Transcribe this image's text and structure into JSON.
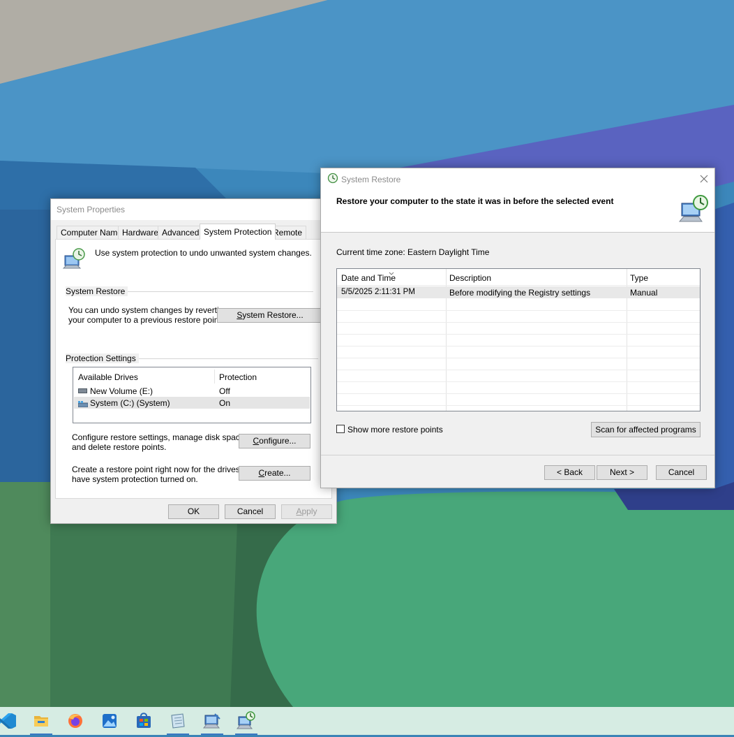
{
  "system_properties": {
    "title": "System Properties",
    "tabs": [
      {
        "label": "Computer Name"
      },
      {
        "label": "Hardware"
      },
      {
        "label": "Advanced"
      },
      {
        "label": "System Protection",
        "active": true
      },
      {
        "label": "Remote"
      }
    ],
    "intro_text": "Use system protection to undo unwanted system changes.",
    "system_restore_group": {
      "title": "System Restore",
      "desc_line1": "You can undo system changes by reverting",
      "desc_line2": "your computer to a previous restore point.",
      "button": "System Restore..."
    },
    "protection_group": {
      "title": "Protection Settings",
      "columns": [
        "Available Drives",
        "Protection"
      ],
      "drives": [
        {
          "name": "New Volume (E:)",
          "protection": "Off"
        },
        {
          "name": "System (C:) (System)",
          "protection": "On",
          "selected": true
        }
      ],
      "configure_line1": "Configure restore settings, manage disk space,",
      "configure_line2": "and delete restore points.",
      "configure_button": "Configure...",
      "create_line1": "Create a restore point right now for the drives that",
      "create_line2": "have system protection turned on.",
      "create_button": "Create..."
    },
    "buttons": {
      "ok": "OK",
      "cancel": "Cancel",
      "apply": "Apply"
    }
  },
  "system_restore": {
    "title": "System Restore",
    "heading": "Restore your computer to the state it was in before the selected event",
    "timezone": "Current time zone: Eastern Daylight Time",
    "columns": [
      "Date and Time",
      "Description",
      "Type"
    ],
    "rows": [
      {
        "date": "5/5/2025 2:11:31 PM",
        "description": "Before modifying the Registry settings",
        "type": "Manual"
      }
    ],
    "show_more_label": "Show more restore points",
    "show_more_checked": false,
    "scan_button": "Scan for affected programs",
    "back_button": "< Back",
    "next_button": "Next >",
    "cancel_button": "Cancel"
  },
  "taskbar": {
    "icons": [
      {
        "name": "vscode-icon",
        "active": false
      },
      {
        "name": "file-explorer-icon",
        "active": true
      },
      {
        "name": "firefox-icon",
        "active": false
      },
      {
        "name": "photos-icon",
        "active": false
      },
      {
        "name": "store-icon",
        "active": false
      },
      {
        "name": "notepad-icon",
        "active": true
      },
      {
        "name": "system-properties-icon",
        "active": true
      },
      {
        "name": "system-restore-icon",
        "active": true
      }
    ]
  },
  "colors": {
    "taskbar": "#d6ece3",
    "accent": "#3a78c2",
    "window_bg": "#f0f0f0"
  }
}
